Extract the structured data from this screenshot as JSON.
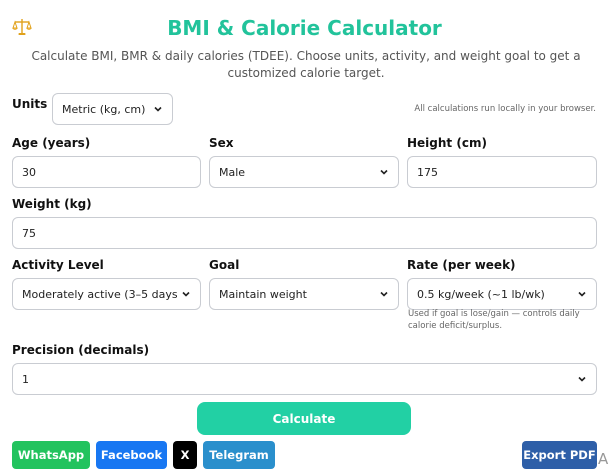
{
  "header": {
    "title": "BMI & Calorie Calculator",
    "subtitle": "Calculate BMI, BMR & daily calories (TDEE). Choose units, activity, and weight goal to get a customized calorie target."
  },
  "units": {
    "label": "Units",
    "selected": "Metric (kg, cm)",
    "note": "All calculations run locally in your browser."
  },
  "fields": {
    "age": {
      "label": "Age (years)",
      "value": "30"
    },
    "sex": {
      "label": "Sex",
      "value": "Male"
    },
    "height": {
      "label": "Height (cm)",
      "value": "175"
    },
    "weight": {
      "label": "Weight (kg)",
      "value": "75"
    },
    "activity": {
      "label": "Activity Level",
      "value": "Moderately active (3–5 days/w"
    },
    "goal": {
      "label": "Goal",
      "value": "Maintain weight"
    },
    "rate": {
      "label": "Rate (per week)",
      "value": "0.5 kg/week (~1 lb/wk)",
      "hint": "Used if goal is lose/gain — controls daily calorie deficit/surplus."
    },
    "precision": {
      "label": "Precision (decimals)",
      "value": "1"
    }
  },
  "actions": {
    "calculate": "Calculate",
    "whatsapp": "WhatsApp",
    "facebook": "Facebook",
    "x": "X",
    "telegram": "Telegram",
    "export_pdf": "Export PDF"
  },
  "corner_glyph": "A",
  "colors": {
    "accent": "#22c39b",
    "calculate": "#22d0a4",
    "whatsapp": "#22c35e",
    "facebook": "#1877f2",
    "x": "#000000",
    "telegram": "#2a8fcc",
    "export_pdf": "#2e5fa8"
  },
  "icons": {
    "logo": "scale-icon",
    "dropdown": "chevron-down-icon"
  }
}
